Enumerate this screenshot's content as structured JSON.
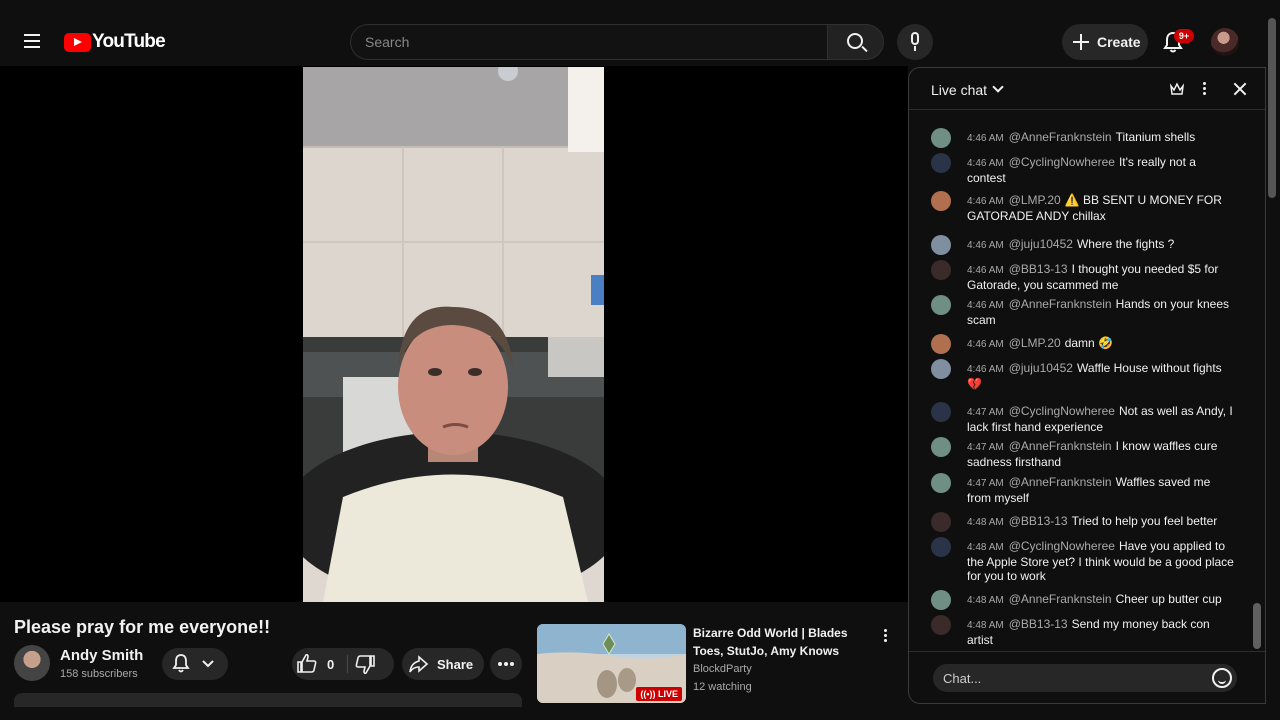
{
  "header": {
    "logo_text": "YouTube",
    "search_placeholder": "Search",
    "create_label": "Create",
    "notifications_badge": "9+"
  },
  "video": {
    "title": "Please pray for me everyone!!",
    "channel_name": "Andy Smith",
    "subscribers": "158 subscribers",
    "like_count": "0",
    "share_label": "Share"
  },
  "recommended": {
    "title": "Bizarre Odd World | Blades Toes, StutJo, Amy Knows",
    "channel": "BlockdParty",
    "watching": "12 watching",
    "live_label": "LIVE"
  },
  "chat": {
    "title": "Live chat",
    "input_placeholder": "Chat...",
    "messages": [
      {
        "time": "4:46 AM",
        "author": "@AnneFranknstein",
        "text": "Titanium shells",
        "avatar": "#6f8f84"
      },
      {
        "time": "4:46 AM",
        "author": "@CyclingNowheree",
        "text": "It's really not a contest",
        "avatar": "#2a3348"
      },
      {
        "time": "4:46 AM",
        "author": "@LMP.20",
        "text": "⚠️ BB SENT U MONEY FOR GATORADE ANDY chillax",
        "avatar": "#b07050"
      },
      {
        "time": "4:46 AM",
        "author": "@juju10452",
        "text": "Where the fights ?",
        "avatar": "#7f8fa0"
      },
      {
        "time": "4:46 AM",
        "author": "@BB13-13",
        "text": "I thought you needed $5 for Gatorade, you scammed me",
        "avatar": "#3a2a2a"
      },
      {
        "time": "4:46 AM",
        "author": "@AnneFranknstein",
        "text": "Hands on your knees scam",
        "avatar": "#6f8f84"
      },
      {
        "time": "4:46 AM",
        "author": "@LMP.20",
        "text": "damn 🤣",
        "avatar": "#b07050"
      },
      {
        "time": "4:46 AM",
        "author": "@juju10452",
        "text": "Waffle House without fights 💔",
        "avatar": "#7f8fa0"
      },
      {
        "time": "4:47 AM",
        "author": "@CyclingNowheree",
        "text": "Not as well as Andy, I lack first hand experience",
        "avatar": "#2a3348"
      },
      {
        "time": "4:47 AM",
        "author": "@AnneFranknstein",
        "text": "I know waffles cure sadness firsthand",
        "avatar": "#6f8f84"
      },
      {
        "time": "4:47 AM",
        "author": "@AnneFranknstein",
        "text": "Waffles saved me from myself",
        "avatar": "#6f8f84"
      },
      {
        "time": "4:48 AM",
        "author": "@BB13-13",
        "text": "Tried to help you feel better",
        "avatar": "#3a2a2a"
      },
      {
        "time": "4:48 AM",
        "author": "@CyclingNowheree",
        "text": "Have you applied to the Apple Store yet? I think would be a good place for you to work",
        "avatar": "#2a3348"
      },
      {
        "time": "4:48 AM",
        "author": "@AnneFranknstein",
        "text": "Cheer up butter cup",
        "avatar": "#6f8f84"
      },
      {
        "time": "4:48 AM",
        "author": "@BB13-13",
        "text": "Send my money back con artist",
        "avatar": "#3a2a2a"
      }
    ]
  }
}
